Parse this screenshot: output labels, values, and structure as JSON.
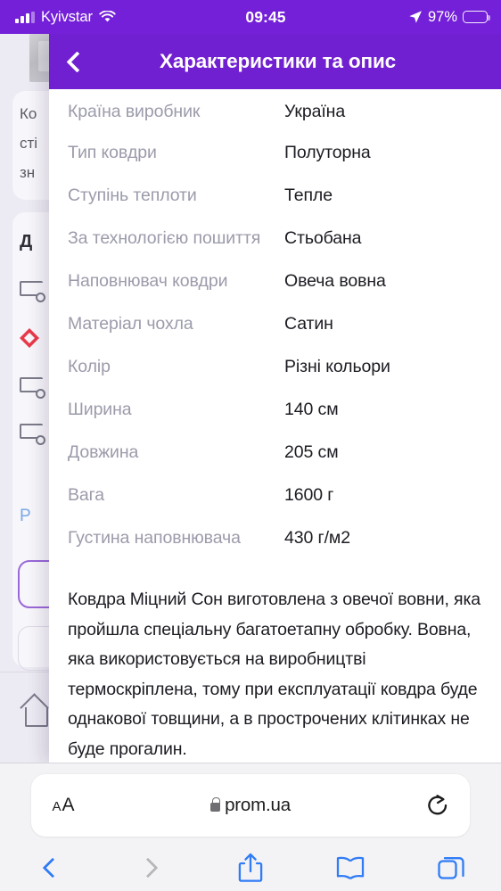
{
  "status_bar": {
    "carrier": "Kyivstar",
    "time": "09:45",
    "battery_percent": "97%",
    "icons": {
      "signal": "cellular-signal-icon",
      "wifi": "wifi-icon",
      "location": "location-arrow-icon",
      "battery": "battery-icon"
    }
  },
  "modal": {
    "back_icon": "chevron-left-icon",
    "title": "Характеристики та опис",
    "specs": [
      {
        "label": "Країна виробник",
        "value": "Україна"
      },
      {
        "label": "Тип ковдри",
        "value": "Полуторна"
      },
      {
        "label": "Ступінь теплоти",
        "value": "Тепле"
      },
      {
        "label": "За технологією пошиття",
        "value": "Стьобана"
      },
      {
        "label": "Наповнювач ковдри",
        "value": "Овеча вовна"
      },
      {
        "label": "Матеріал чохла",
        "value": "Сатин"
      },
      {
        "label": "Колір",
        "value": "Різні кольори"
      },
      {
        "label": "Ширина",
        "value": "140 см"
      },
      {
        "label": "Довжина",
        "value": "205 см"
      },
      {
        "label": "Вага",
        "value": "1600 г"
      },
      {
        "label": "Густина наповнювача",
        "value": "430 г/м2"
      }
    ],
    "description": "Ковдра Міцний Сон виготовлена з овечої вовни, яка пройшла спеціальну багатоетапну обробку. Вовна, яка використовується на виробництві термоскріплена, тому при експлуатації ковдра буде однакової товщини, а в прострочених клітинках не буде прогалин."
  },
  "background_page": {
    "text_line_1": "Ко",
    "text_line_2": "сті",
    "text_line_3": "зн",
    "heading": "Д",
    "link": "P"
  },
  "safari": {
    "text_size_small": "A",
    "text_size_large": "A",
    "lock_icon": "lock-icon",
    "url": "prom.ua",
    "reload_icon": "reload-icon",
    "toolbar": {
      "back_icon": "chevron-left-icon",
      "forward_icon": "chevron-right-icon",
      "share_icon": "share-icon",
      "bookmarks_icon": "book-icon",
      "tabs_icon": "tabs-icon"
    }
  },
  "colors": {
    "status_bar_purple": "#7420d8",
    "header_purple": "#7020d0",
    "label_gray": "#9b9bab",
    "value_black": "#1b1b22",
    "safari_blue": "#2f7cf6",
    "safari_bar_gray": "#f3f2f5"
  }
}
